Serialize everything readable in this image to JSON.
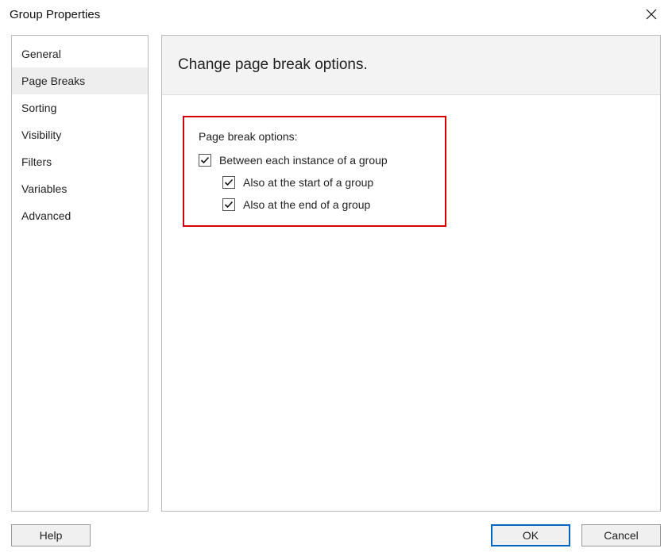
{
  "window": {
    "title": "Group Properties"
  },
  "sidebar": {
    "items": [
      {
        "label": "General",
        "selected": false
      },
      {
        "label": "Page Breaks",
        "selected": true
      },
      {
        "label": "Sorting",
        "selected": false
      },
      {
        "label": "Visibility",
        "selected": false
      },
      {
        "label": "Filters",
        "selected": false
      },
      {
        "label": "Variables",
        "selected": false
      },
      {
        "label": "Advanced",
        "selected": false
      }
    ]
  },
  "panel": {
    "heading": "Change page break options.",
    "section_label": "Page break options:",
    "options": [
      {
        "label": "Between each instance of a group",
        "checked": true,
        "indented": false
      },
      {
        "label": "Also at the start of a group",
        "checked": true,
        "indented": true
      },
      {
        "label": "Also at the end of a group",
        "checked": true,
        "indented": true
      }
    ]
  },
  "buttons": {
    "help": "Help",
    "ok": "OK",
    "cancel": "Cancel"
  }
}
